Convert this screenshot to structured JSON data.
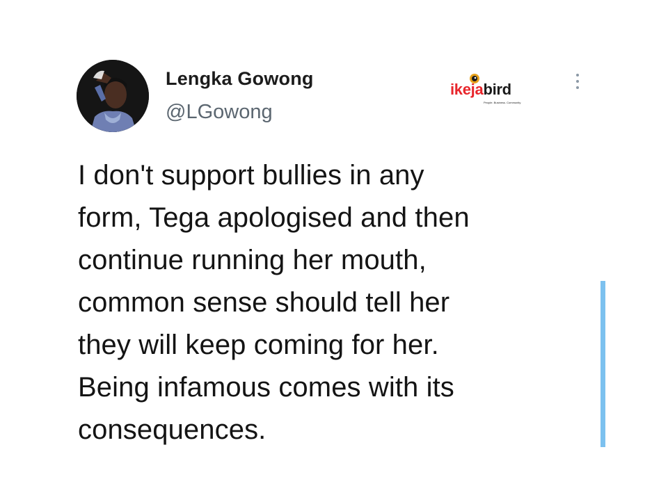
{
  "author": {
    "display_name": "Lengka Gowong",
    "handle": "@LGowong"
  },
  "watermark": {
    "brand_red": "ikeja",
    "brand_black": "bird",
    "tagline": "People. Business. Community",
    "red_color": "#e8262c"
  },
  "tweet": {
    "lines": [
      "I don't support bullies in any",
      "form, Tega apologised and then",
      "continue running her mouth,",
      "common sense should tell her",
      "they will keep coming for her.",
      "Being infamous comes with its",
      "consequences."
    ]
  },
  "icons": {
    "more": "more-vertical-icon",
    "logo_bird": "bird-icon"
  },
  "colors": {
    "scroll_indicator": "#7cc1ef",
    "handle": "#5b6670"
  }
}
